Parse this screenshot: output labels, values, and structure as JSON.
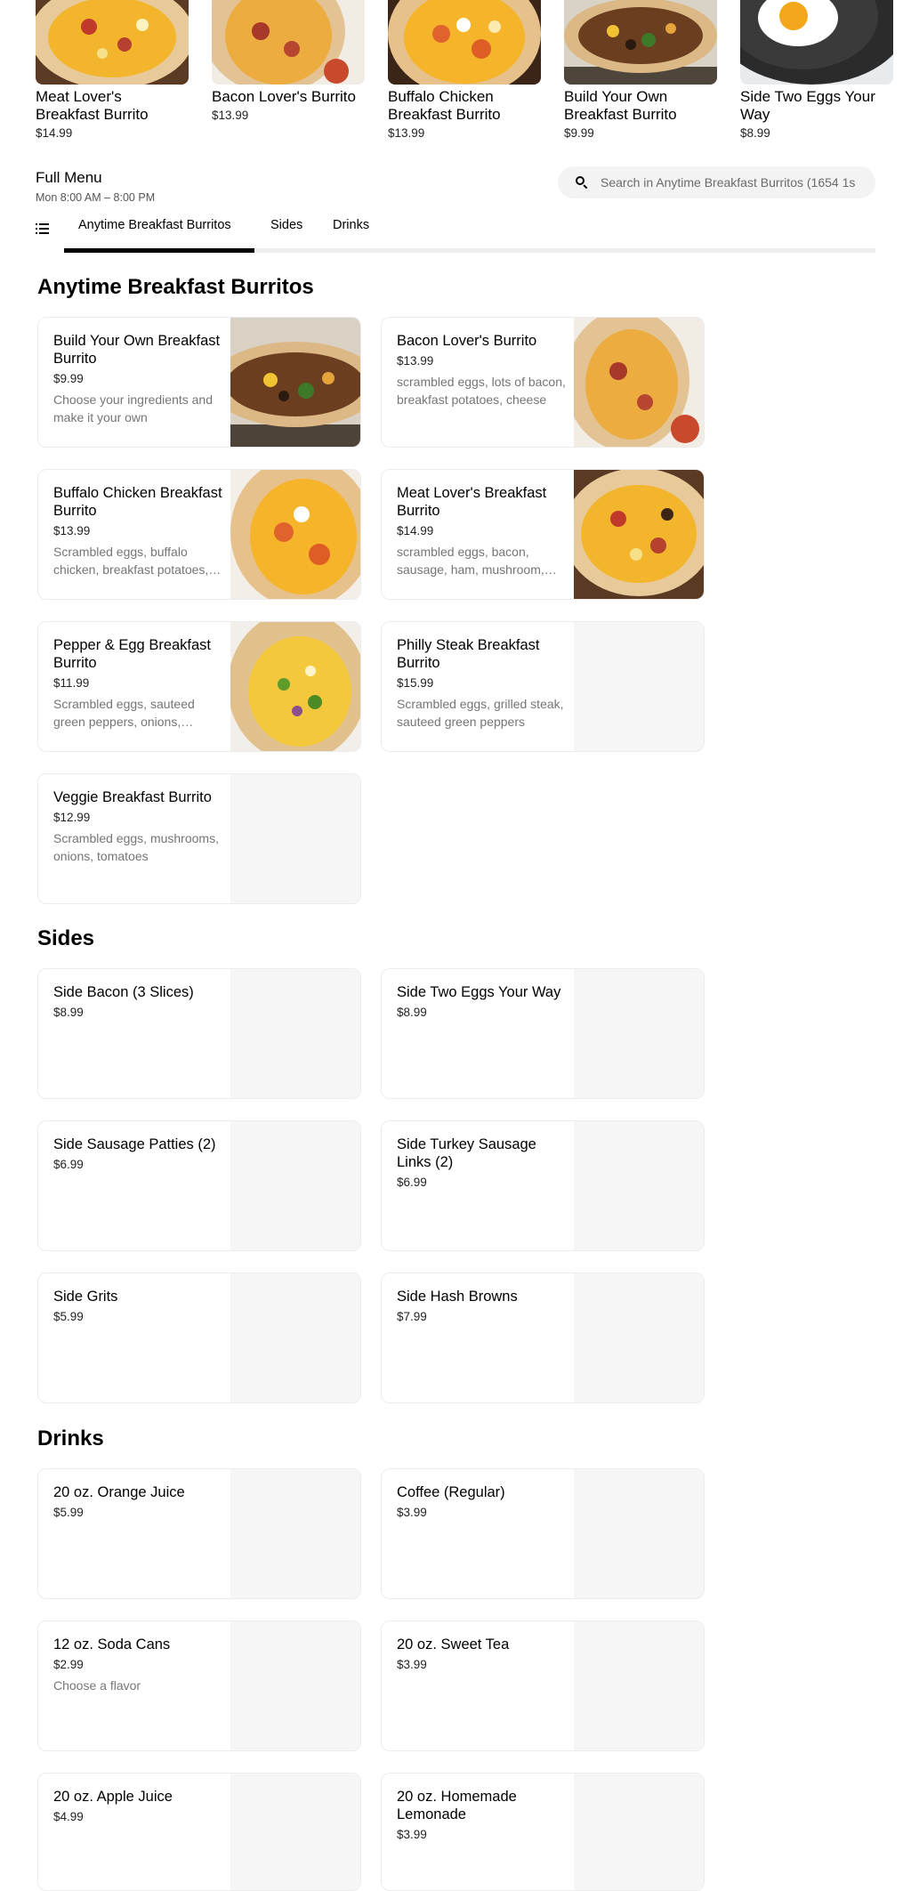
{
  "featured": [
    {
      "name": "Meat Lover's Breakfast Burrito",
      "price": "$14.99",
      "img": "burrito"
    },
    {
      "name": "Bacon Lover's Burrito",
      "price": "$13.99",
      "img": "burrito"
    },
    {
      "name": "Buffalo Chicken Breakfast Burrito",
      "price": "$13.99",
      "img": "burrito"
    },
    {
      "name": "Build Your Own Breakfast Burrito",
      "price": "$9.99",
      "img": "burrito"
    },
    {
      "name": "Side Two Eggs Your Way",
      "price": "$8.99",
      "img": "egg-pan"
    }
  ],
  "menu": {
    "title": "Full Menu",
    "hours": "Mon 8:00 AM – 8:00 PM"
  },
  "search": {
    "placeholder": "Search in Anytime Breakfast Burritos (1654 1s"
  },
  "tabs": [
    {
      "label": "Anytime Breakfast Burritos",
      "active": true
    },
    {
      "label": "Sides",
      "active": false
    },
    {
      "label": "Drinks",
      "active": false
    }
  ],
  "sections": {
    "burritos": {
      "title": "Anytime Breakfast Burritos",
      "items": [
        {
          "name": "Build Your Own Breakfast Burrito",
          "price": "$9.99",
          "desc": "Choose your ingredients and make it your own",
          "has_image": true
        },
        {
          "name": "Bacon Lover's Burrito",
          "price": "$13.99",
          "desc": "scrambled eggs, lots of bacon, breakfast potatoes, cheese",
          "has_image": true
        },
        {
          "name": "Buffalo Chicken Breakfast Burrito",
          "price": "$13.99",
          "desc": "Scrambled eggs, buffalo chicken, breakfast potatoes, cheese",
          "has_image": true
        },
        {
          "name": "Meat Lover's Breakfast Burrito",
          "price": "$14.99",
          "desc": "scrambled eggs, bacon, sausage, ham, mushroom, cheese",
          "has_image": true
        },
        {
          "name": "Pepper & Egg Breakfast Burrito",
          "price": "$11.99",
          "desc": "Scrambled eggs, sauteed green peppers, onions, cheese",
          "has_image": true
        },
        {
          "name": "Philly Steak Breakfast Burrito",
          "price": "$15.99",
          "desc": "Scrambled eggs, grilled steak, sauteed green peppers",
          "has_image": false
        },
        {
          "name": "Veggie Breakfast Burrito",
          "price": "$12.99",
          "desc": "Scrambled eggs, mushrooms, onions, tomatoes",
          "has_image": false
        }
      ]
    },
    "sides": {
      "title": "Sides",
      "items": [
        {
          "name": "Side Bacon (3 Slices)",
          "price": "$8.99",
          "desc": ""
        },
        {
          "name": "Side Two Eggs Your Way",
          "price": "$8.99",
          "desc": ""
        },
        {
          "name": "Side Sausage Patties (2)",
          "price": "$6.99",
          "desc": ""
        },
        {
          "name": "Side Turkey Sausage Links (2)",
          "price": "$6.99",
          "desc": ""
        },
        {
          "name": "Side Grits",
          "price": "$5.99",
          "desc": ""
        },
        {
          "name": "Side Hash Browns",
          "price": "$7.99",
          "desc": ""
        }
      ]
    },
    "drinks": {
      "title": "Drinks",
      "items": [
        {
          "name": "20 oz. Orange Juice",
          "price": "$5.99",
          "desc": ""
        },
        {
          "name": "Coffee (Regular)",
          "price": "$3.99",
          "desc": ""
        },
        {
          "name": "12 oz. Soda Cans",
          "price": "$2.99",
          "desc": "Choose a flavor"
        },
        {
          "name": "20 oz. Sweet Tea",
          "price": "$3.99",
          "desc": ""
        },
        {
          "name": "20 oz. Apple Juice",
          "price": "$4.99",
          "desc": ""
        },
        {
          "name": "20 oz. Homemade Lemonade",
          "price": "$3.99",
          "desc": ""
        }
      ]
    }
  }
}
